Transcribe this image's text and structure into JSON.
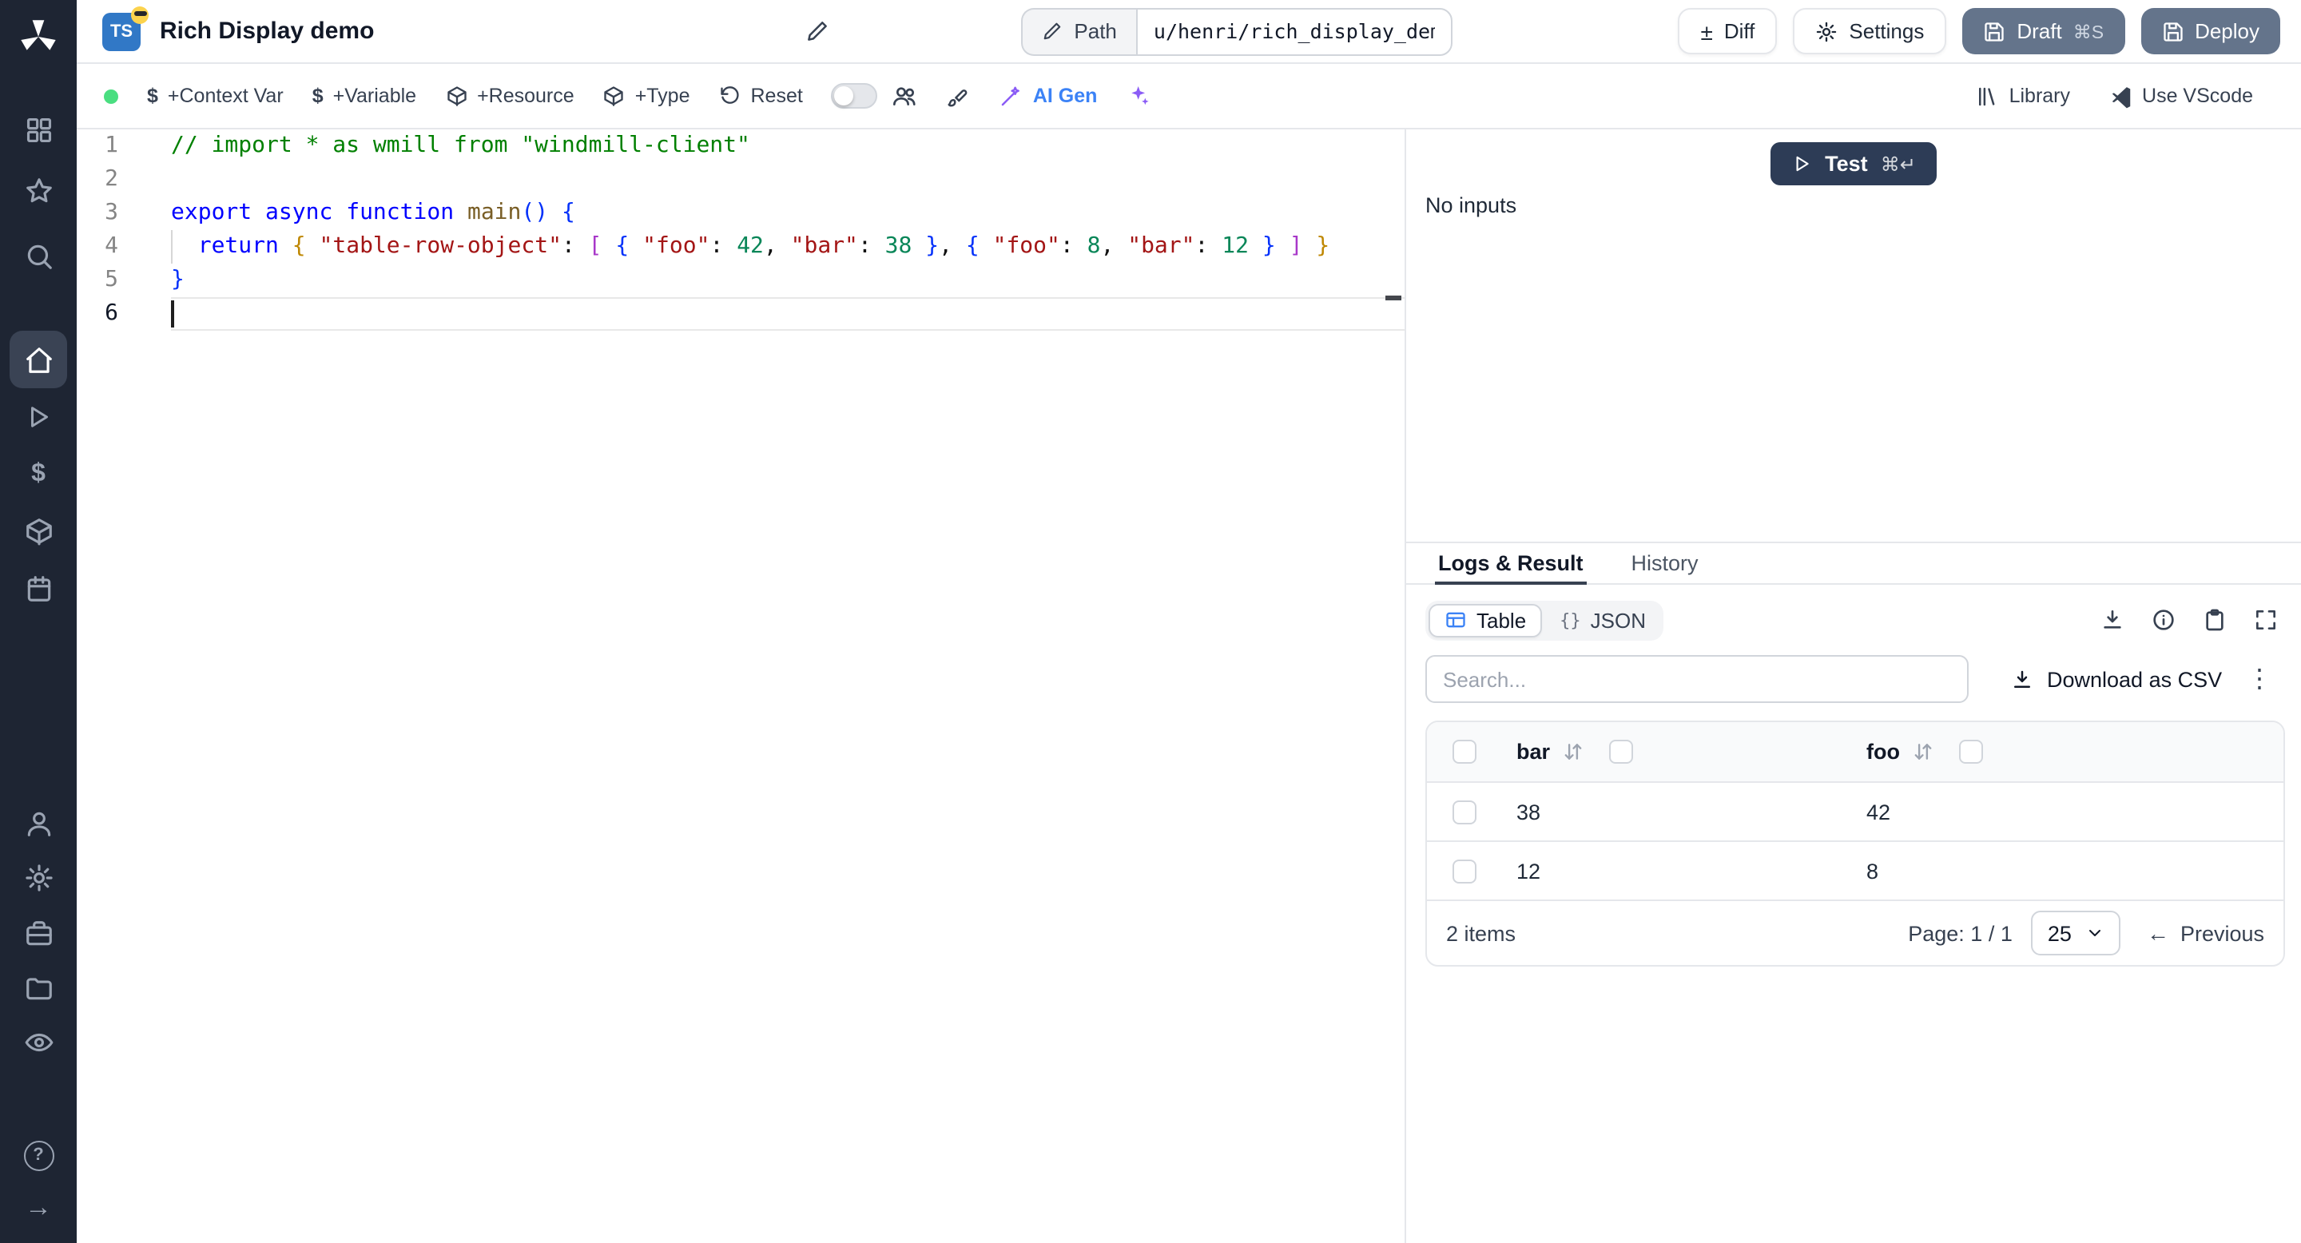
{
  "topbar": {
    "lang_badge": "TS",
    "title": "Rich Display demo",
    "path_label": "Path",
    "path_value": "u/henri/rich_display_demo",
    "diff_label": "Diff",
    "settings_label": "Settings",
    "draft_label": "Draft",
    "draft_shortcut": "⌘S",
    "deploy_label": "Deploy"
  },
  "toolbar": {
    "context_var_label": "+Context Var",
    "variable_label": "+Variable",
    "resource_label": "+Resource",
    "type_label": "+Type",
    "reset_label": "Reset",
    "ai_gen_label": "AI Gen",
    "library_label": "Library",
    "vscode_label": "Use VScode"
  },
  "editor": {
    "lines": [
      {
        "n": "1",
        "tokens": [
          {
            "t": "// import * as wmill from \"windmill-client\"",
            "c": "cmt"
          }
        ]
      },
      {
        "n": "2",
        "tokens": []
      },
      {
        "n": "3",
        "tokens": [
          {
            "t": "export",
            "c": "kw"
          },
          {
            "t": " "
          },
          {
            "t": "async",
            "c": "kw"
          },
          {
            "t": " "
          },
          {
            "t": "function",
            "c": "kw"
          },
          {
            "t": " "
          },
          {
            "t": "main",
            "c": "fn"
          },
          {
            "t": "()",
            "c": "b1"
          },
          {
            "t": " "
          },
          {
            "t": "{",
            "c": "b1"
          }
        ]
      },
      {
        "n": "4",
        "guide": true,
        "tokens": [
          {
            "t": "  "
          },
          {
            "t": "return",
            "c": "kw"
          },
          {
            "t": " "
          },
          {
            "t": "{",
            "c": "b2"
          },
          {
            "t": " "
          },
          {
            "t": "\"table-row-object\"",
            "c": "str"
          },
          {
            "t": ": "
          },
          {
            "t": "[",
            "c": "b3"
          },
          {
            "t": " "
          },
          {
            "t": "{",
            "c": "b1"
          },
          {
            "t": " "
          },
          {
            "t": "\"foo\"",
            "c": "str"
          },
          {
            "t": ": "
          },
          {
            "t": "42",
            "c": "num"
          },
          {
            "t": ", "
          },
          {
            "t": "\"bar\"",
            "c": "str"
          },
          {
            "t": ": "
          },
          {
            "t": "38",
            "c": "num"
          },
          {
            "t": " "
          },
          {
            "t": "}",
            "c": "b1"
          },
          {
            "t": ", "
          },
          {
            "t": "{",
            "c": "b1"
          },
          {
            "t": " "
          },
          {
            "t": "\"foo\"",
            "c": "str"
          },
          {
            "t": ": "
          },
          {
            "t": "8",
            "c": "num"
          },
          {
            "t": ", "
          },
          {
            "t": "\"bar\"",
            "c": "str"
          },
          {
            "t": ": "
          },
          {
            "t": "12",
            "c": "num"
          },
          {
            "t": " "
          },
          {
            "t": "}",
            "c": "b1"
          },
          {
            "t": " "
          },
          {
            "t": "]",
            "c": "b3"
          },
          {
            "t": " "
          },
          {
            "t": "}",
            "c": "b2"
          }
        ]
      },
      {
        "n": "5",
        "tokens": [
          {
            "t": "}",
            "c": "b1"
          }
        ]
      },
      {
        "n": "6",
        "active": true,
        "cursor": true,
        "tokens": []
      }
    ]
  },
  "runner": {
    "test_label": "Test",
    "test_shortcut": "⌘↵",
    "no_inputs": "No inputs"
  },
  "result_panel": {
    "tabs": [
      {
        "label": "Logs & Result"
      },
      {
        "label": "History"
      }
    ],
    "view_toggle": [
      {
        "label": "Table"
      },
      {
        "label": "JSON"
      }
    ],
    "search_placeholder": "Search...",
    "download_csv_label": "Download as CSV",
    "table": {
      "columns": [
        "bar",
        "foo"
      ],
      "rows": [
        [
          "38",
          "42"
        ],
        [
          "12",
          "8"
        ]
      ],
      "items_label": "2 items",
      "page_label": "Page: 1 / 1",
      "page_size": "25",
      "previous_label": "Previous"
    }
  },
  "icons": {
    "dollar": "$",
    "plus_minus": "±",
    "json_braces": "{}",
    "kebab": "⋮",
    "prev_arrow": "←",
    "help": "?",
    "expand_arrow": "→"
  }
}
